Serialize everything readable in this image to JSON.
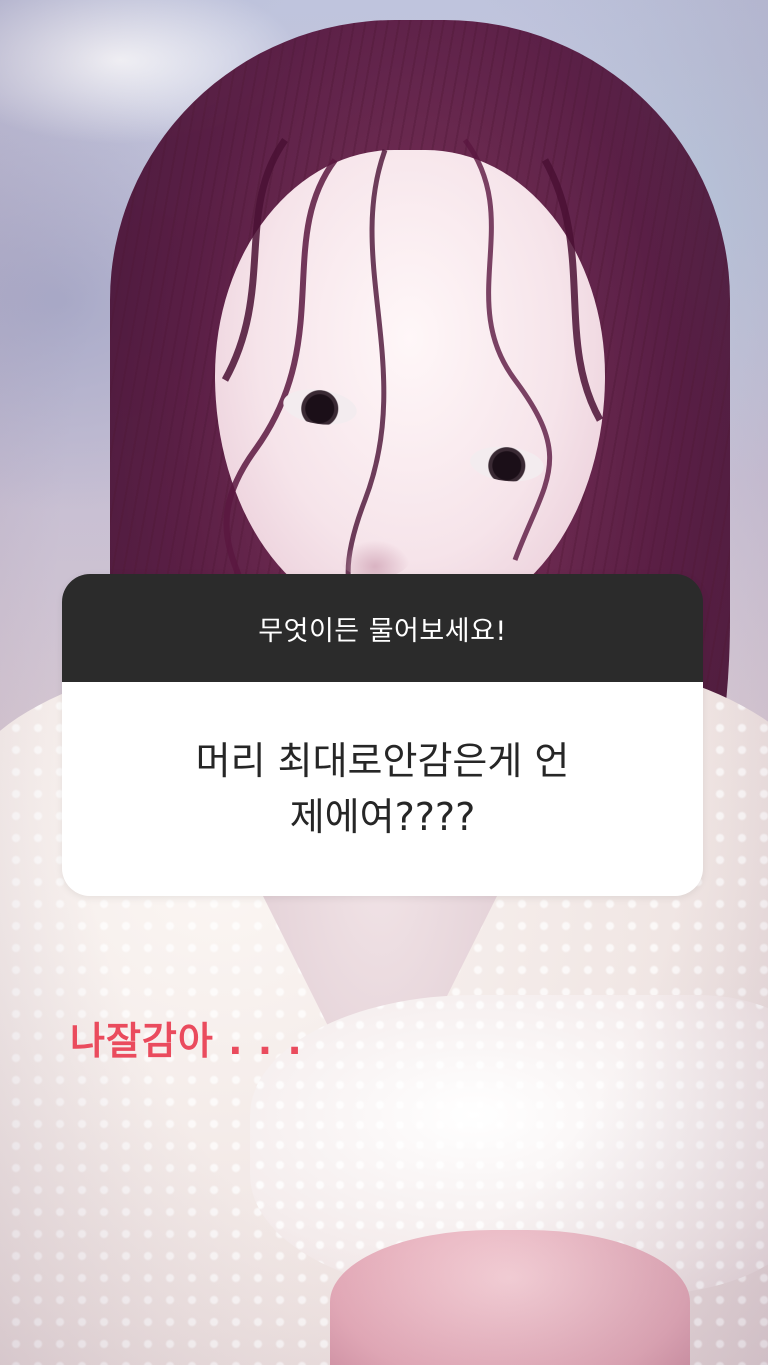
{
  "story": {
    "question_sticker": {
      "prompt": "무엇이든 물어보세요!",
      "question_line1": "머리 최대로안감은게 언",
      "question_line2": "제에여????"
    },
    "reply_caption": "나잘감아 . . .",
    "colors": {
      "sticker_header": "#2b2b2b",
      "sticker_body": "#ffffff",
      "caption_text": "#ea4b5d"
    }
  }
}
